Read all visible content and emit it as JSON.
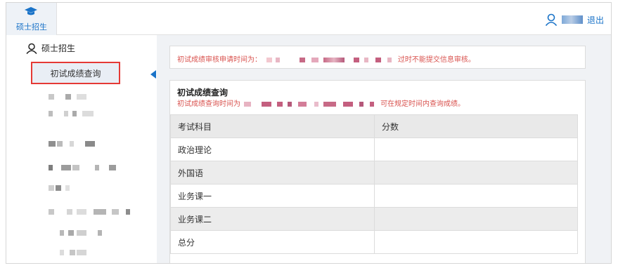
{
  "topbar": {
    "tab_label": "硕士招生",
    "logout_label": "退出"
  },
  "sidebar": {
    "header_label": "硕士招生",
    "active_item_label": "初试成绩查询"
  },
  "notice": {
    "prefix": "初试成绩审核申请时间为：",
    "suffix": "过时不能提交信息审核。"
  },
  "panel": {
    "title": "初试成绩查询",
    "sub_prefix": "初试成绩查询时间为",
    "sub_suffix": "可在规定时间内查询成绩。"
  },
  "table": {
    "headers": [
      "考试科目",
      "分数"
    ],
    "rows": [
      {
        "subject": "政治理论",
        "score": ""
      },
      {
        "subject": "外国语",
        "score": ""
      },
      {
        "subject": "业务课一",
        "score": ""
      },
      {
        "subject": "业务课二",
        "score": ""
      },
      {
        "subject": "总分",
        "score": ""
      }
    ]
  },
  "colors": {
    "accent": "#1a73c8",
    "highlight_border": "#e53935",
    "warning_text": "#d9534f"
  },
  "icons": {
    "logo": "graduation-cap-icon",
    "user": "user-icon",
    "sidebar_head": "user-icon",
    "collapse": "caret-left-icon"
  }
}
